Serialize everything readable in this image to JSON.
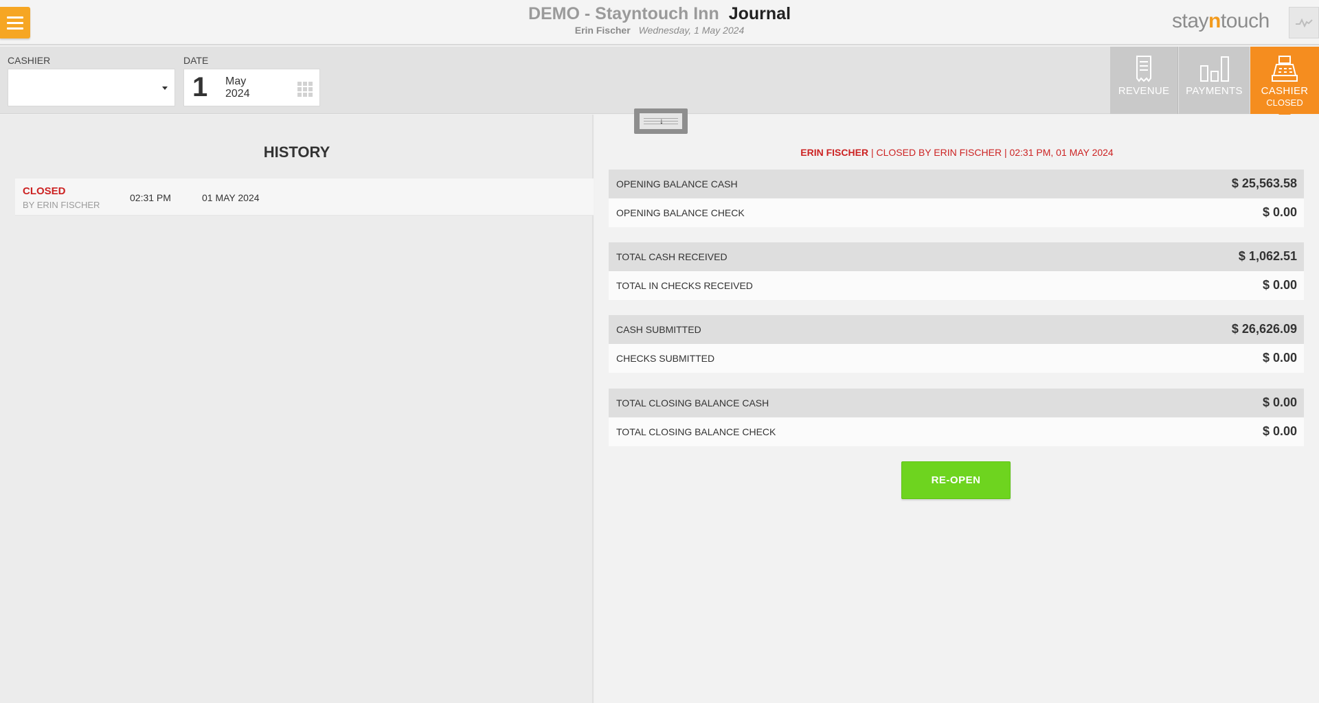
{
  "header": {
    "hotel_name": "DEMO - Stayntouch Inn",
    "page_title": "Journal",
    "user_name": "Erin Fischer",
    "business_date": "Wednesday, 1 May 2024",
    "logo_prefix": "stay",
    "logo_accent": "n",
    "logo_suffix": "touch"
  },
  "filters": {
    "cashier_label": "CASHIER",
    "cashier_value": "",
    "date_label": "DATE",
    "date_day": "1",
    "date_month": "May",
    "date_year": "2024"
  },
  "tabs": [
    {
      "label": "REVENUE",
      "icon": "receipt-icon"
    },
    {
      "label": "PAYMENTS",
      "icon": "bar-chart-icon"
    },
    {
      "label": "CASHIER",
      "sub_label": "CLOSED",
      "icon": "cash-register-icon",
      "active": true
    }
  ],
  "history": {
    "title": "HISTORY",
    "entries": [
      {
        "status": "CLOSED",
        "by": "BY ERIN FISCHER",
        "time": "02:31 PM",
        "date": "01 MAY 2024"
      }
    ]
  },
  "details": {
    "closed_by_name": "ERIN FISCHER",
    "closed_by_info": " | CLOSED BY ERIN FISCHER | 02:31 PM, 01 MAY 2024",
    "rows": [
      {
        "label": "OPENING BALANCE CASH",
        "value": "$ 25,563.58"
      },
      {
        "label": "OPENING BALANCE CHECK",
        "value": "$ 0.00"
      },
      {
        "label": "TOTAL CASH RECEIVED",
        "value": "$ 1,062.51"
      },
      {
        "label": "TOTAL IN CHECKS RECEIVED",
        "value": "$ 0.00"
      },
      {
        "label": "CASH SUBMITTED",
        "value": "$ 26,626.09"
      },
      {
        "label": "CHECKS SUBMITTED",
        "value": "$ 0.00"
      },
      {
        "label": "TOTAL CLOSING BALANCE CASH",
        "value": "$ 0.00"
      },
      {
        "label": "TOTAL CLOSING BALANCE CHECK",
        "value": "$ 0.00"
      }
    ],
    "reopen_label": "RE-OPEN"
  },
  "colors": {
    "accent": "#f58d1f",
    "menu": "#f6a623",
    "closed_red": "#cc2222",
    "reopen_green": "#6ed41f"
  }
}
